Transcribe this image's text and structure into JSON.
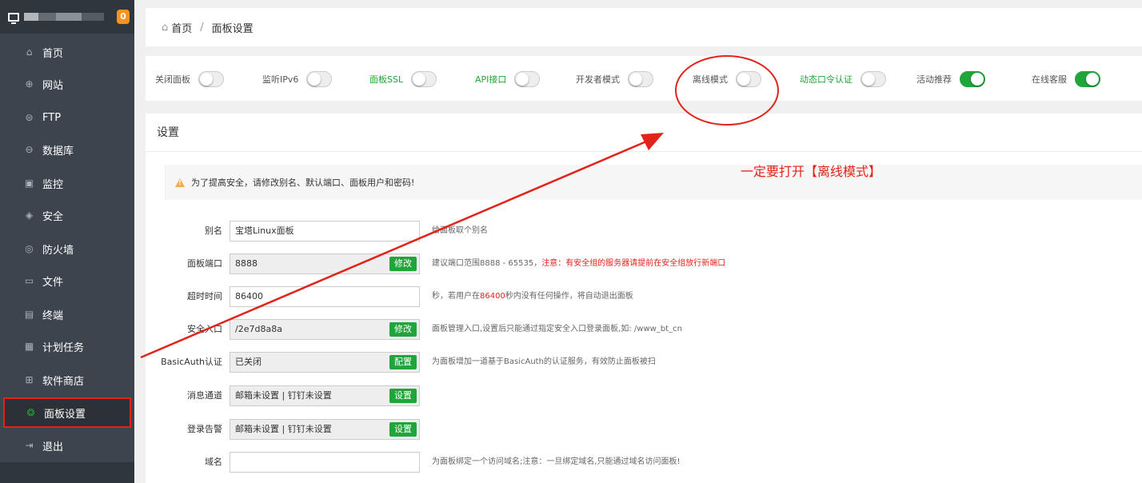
{
  "sidebar": {
    "badge": "0",
    "items": [
      {
        "label": "首页",
        "icon": "home-icon",
        "glyph": "⌂"
      },
      {
        "label": "网站",
        "icon": "globe-icon",
        "glyph": "⊕"
      },
      {
        "label": "FTP",
        "icon": "ftp-icon",
        "glyph": "⊜"
      },
      {
        "label": "数据库",
        "icon": "database-icon",
        "glyph": "⊖"
      },
      {
        "label": "监控",
        "icon": "monitor-icon",
        "glyph": "▣"
      },
      {
        "label": "安全",
        "icon": "shield-icon",
        "glyph": "◈"
      },
      {
        "label": "防火墙",
        "icon": "firewall-icon",
        "glyph": "◎"
      },
      {
        "label": "文件",
        "icon": "folder-icon",
        "glyph": "▭"
      },
      {
        "label": "终端",
        "icon": "terminal-icon",
        "glyph": "▤"
      },
      {
        "label": "计划任务",
        "icon": "calendar-icon",
        "glyph": "▦"
      },
      {
        "label": "软件商店",
        "icon": "apps-icon",
        "glyph": "⊞"
      },
      {
        "label": "面板设置",
        "icon": "gear-icon",
        "glyph": "❂",
        "active": true
      },
      {
        "label": "退出",
        "icon": "logout-icon",
        "glyph": "⇥"
      }
    ]
  },
  "breadcrumb": {
    "home": "首页",
    "separator": "/",
    "current": "面板设置"
  },
  "switches": [
    {
      "label": "关闭面板",
      "on": false,
      "green": false
    },
    {
      "label": "监听IPv6",
      "on": false,
      "green": false
    },
    {
      "label": "面板SSL",
      "on": false,
      "green": true
    },
    {
      "label": "API接口",
      "on": false,
      "green": true
    },
    {
      "label": "开发者模式",
      "on": false,
      "green": false
    },
    {
      "label": "离线模式",
      "on": false,
      "green": false
    },
    {
      "label": "动态口令认证",
      "on": false,
      "green": true
    },
    {
      "label": "活动推荐",
      "on": true,
      "green": false
    },
    {
      "label": "在线客服",
      "on": true,
      "green": false
    }
  ],
  "settings": {
    "title": "设置",
    "warning": "为了提高安全，请修改别名、默认端口、面板用户和密码!",
    "rows": [
      {
        "label": "别名",
        "value": "宝塔Linux面板",
        "readonly": false,
        "button": "",
        "hint": "给面板取个别名",
        "hint_red": "",
        "hint_red2": "",
        "hint_tail": ""
      },
      {
        "label": "面板端口",
        "value": "8888",
        "readonly": true,
        "button": "修改",
        "hint": "建议端口范围8888 - 65535，",
        "hint_red": "注意：有安全组的服务器请提前在安全组放行新端口",
        "hint_red2": "",
        "hint_tail": ""
      },
      {
        "label": "超时时间",
        "value": "86400",
        "readonly": false,
        "button": "",
        "hint": "秒，若用户在",
        "hint_red": "86400",
        "hint_red2": "",
        "hint_tail": "秒内没有任何操作，将自动退出面板"
      },
      {
        "label": "安全入口",
        "value": "/2e7d8a8a",
        "readonly": true,
        "button": "修改",
        "hint": "面板管理入口,设置后只能通过指定安全入口登录面板,如: /www_bt_cn",
        "hint_red": "",
        "hint_red2": "",
        "hint_tail": ""
      },
      {
        "label": "BasicAuth认证",
        "value": "已关闭",
        "readonly": true,
        "button": "配置",
        "hint": "为面板增加一道基于BasicAuth的认证服务，有效防止面板被扫",
        "hint_red": "",
        "hint_red2": "",
        "hint_tail": ""
      },
      {
        "label": "消息通道",
        "value": "邮箱未设置 | 钉钉未设置",
        "readonly": true,
        "button": "设置",
        "hint": "",
        "hint_red": "",
        "hint_red2": "",
        "hint_tail": ""
      },
      {
        "label": "登录告警",
        "value": "邮箱未设置 | 钉钉未设置",
        "readonly": true,
        "button": "设置",
        "hint": "",
        "hint_red": "",
        "hint_red2": "",
        "hint_tail": ""
      },
      {
        "label": "域名",
        "value": "",
        "readonly": false,
        "button": "",
        "hint": "为面板绑定一个访问域名;注意：一旦绑定域名,只能通过域名访问面板!",
        "hint_red": "",
        "hint_red2": "",
        "hint_tail": ""
      }
    ]
  },
  "annotation": {
    "text": "一定要打开【离线模式】",
    "color": "#e2231a"
  },
  "colors": {
    "accent_green": "#20a53a",
    "annotation_red": "#e2231a",
    "sidebar_bg": "#3c444d"
  }
}
